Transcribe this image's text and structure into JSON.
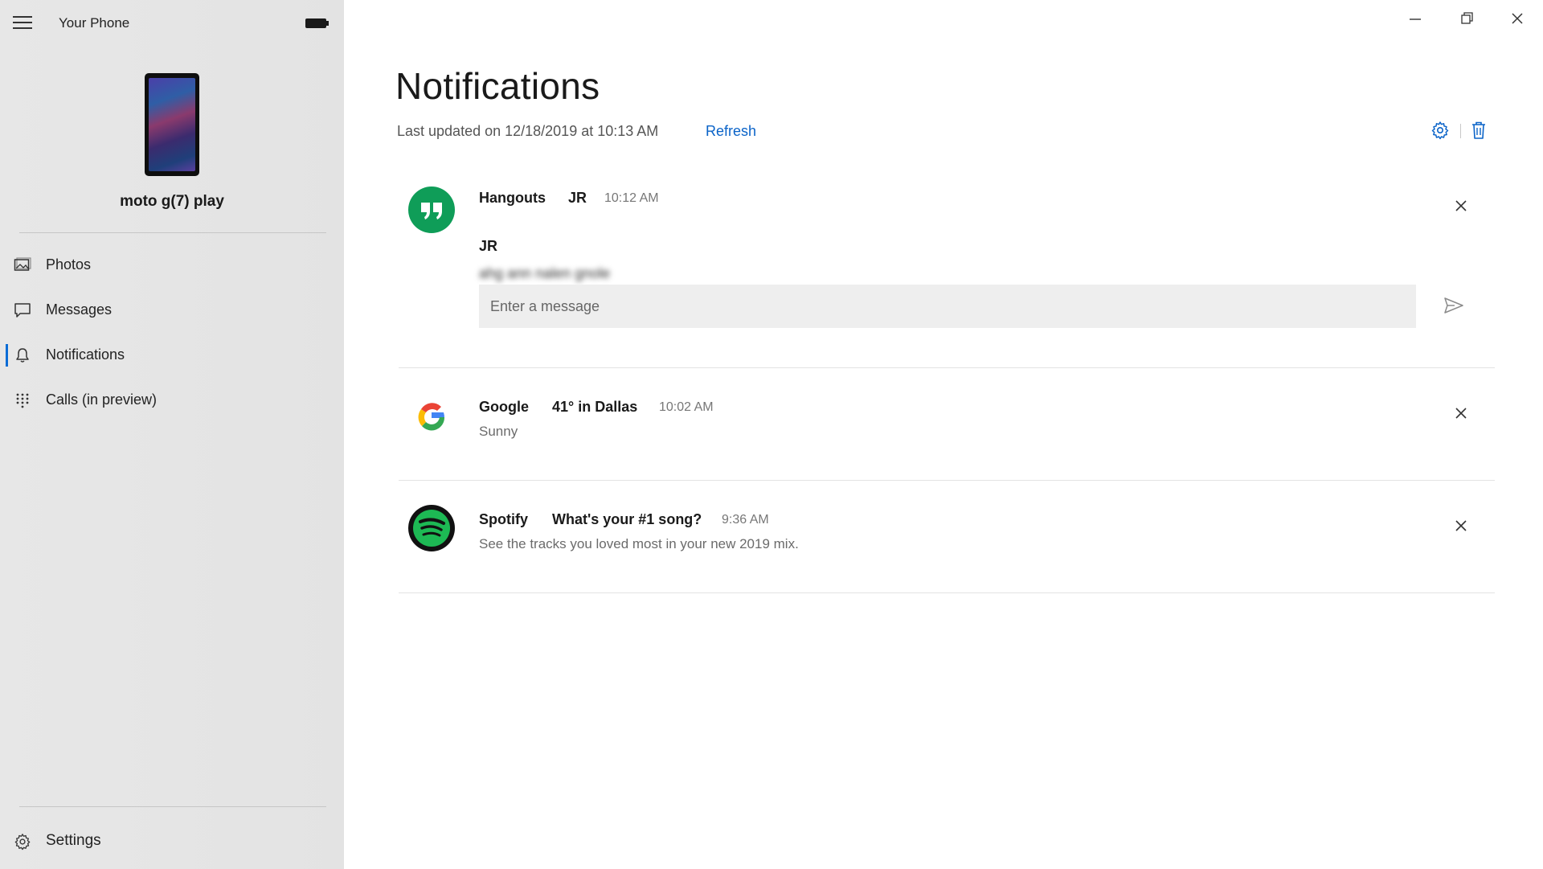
{
  "app": {
    "title": "Your Phone",
    "device_name": "moto g(7) play"
  },
  "sidebar": {
    "items": [
      {
        "label": "Photos",
        "icon": "photos-icon"
      },
      {
        "label": "Messages",
        "icon": "messages-icon"
      },
      {
        "label": "Notifications",
        "icon": "bell-icon",
        "active": true
      },
      {
        "label": "Calls (in preview)",
        "icon": "dialpad-icon"
      }
    ],
    "settings_label": "Settings"
  },
  "main": {
    "title": "Notifications",
    "last_updated": "Last updated on 12/18/2019 at 10:13 AM",
    "refresh_label": "Refresh",
    "accent_color": "#0a63c8"
  },
  "notifications": [
    {
      "app": "Hangouts",
      "title": "JR",
      "time": "10:12 AM",
      "sender": "JR",
      "body": "ahg ann nalen gnole",
      "reply_placeholder": "Enter a message",
      "icon_color": "#0f9d58"
    },
    {
      "app": "Google",
      "title": "41° in Dallas",
      "time": "10:02 AM",
      "body": "Sunny"
    },
    {
      "app": "Spotify",
      "title": "What's your #1 song?",
      "time": "9:36 AM",
      "body": "See the tracks you loved most in your new 2019 mix.",
      "icon_color": "#1db954"
    }
  ]
}
